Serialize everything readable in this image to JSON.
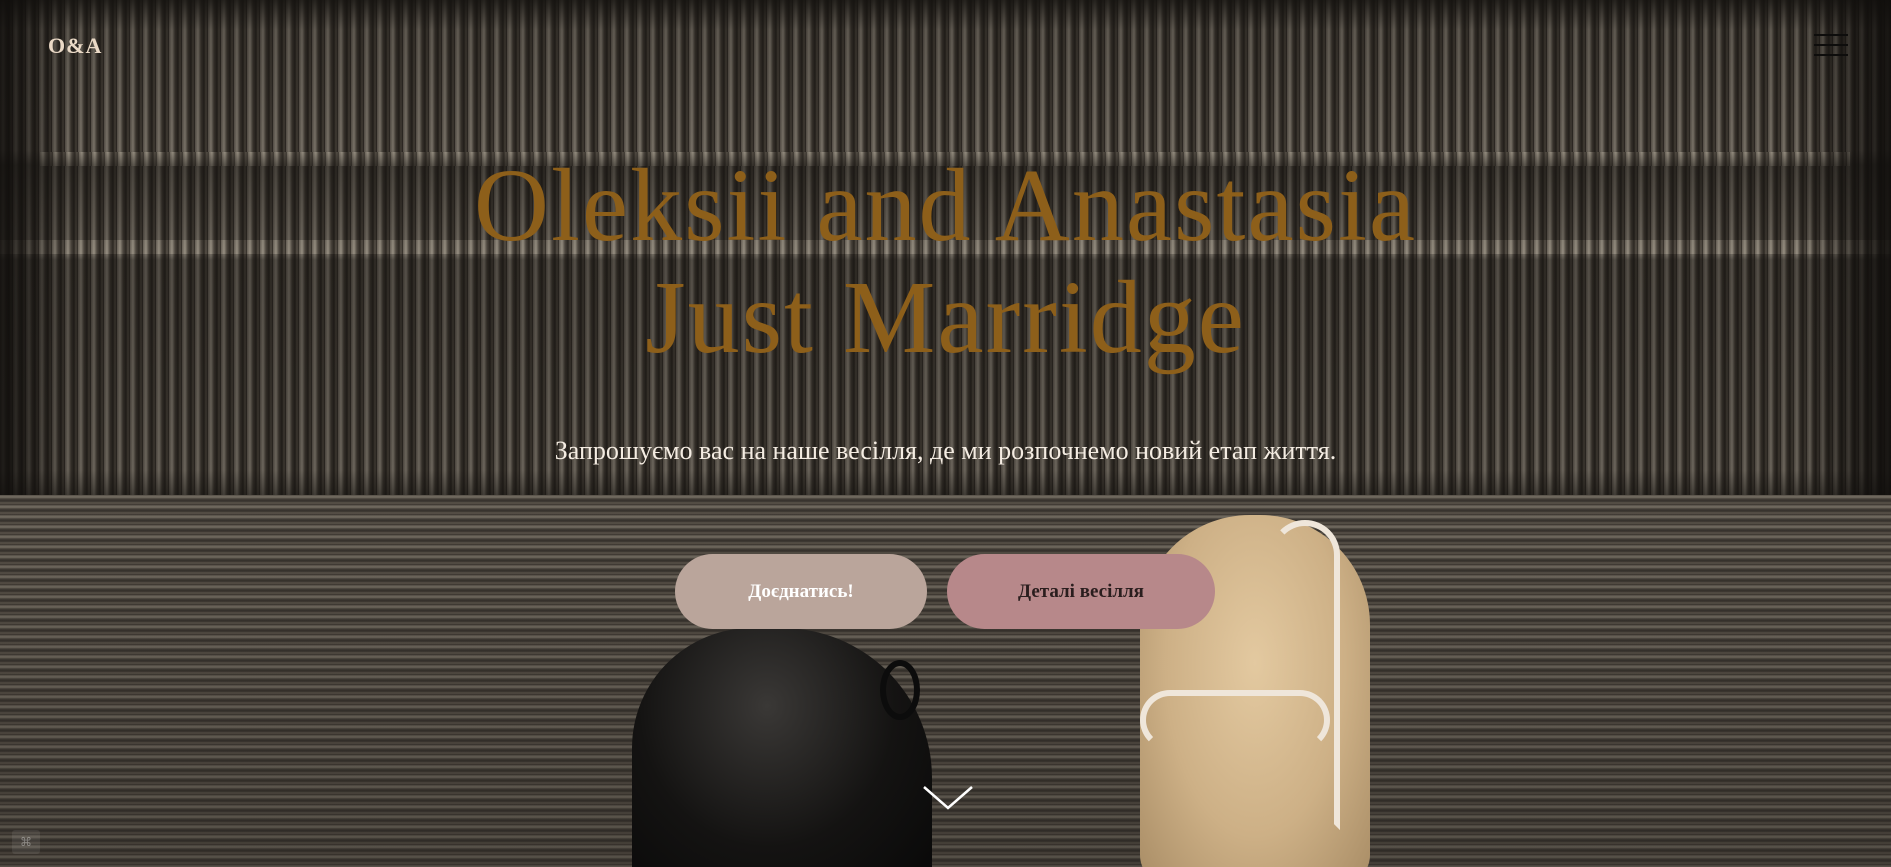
{
  "header": {
    "logo": "O&A",
    "menu_icon": "hamburger-menu-icon"
  },
  "hero": {
    "title_line1": "Oleksii and Anastasia",
    "title_line2": "Just Marridge",
    "subtitle": "Запрошуємо вас на наше весілля, де ми розпочнемо новий етап життя.",
    "title_color": "#8d5f1a",
    "background_image": "escalator-steps-with-shoes-photo"
  },
  "buttons": {
    "join_label": "Доєднатись!",
    "details_label": "Деталі весілля",
    "join_color": "#baa59b",
    "details_color": "#b7888a"
  },
  "scroll": {
    "icon": "chevron-down-icon"
  },
  "corner": {
    "icon": "widget-icon"
  }
}
